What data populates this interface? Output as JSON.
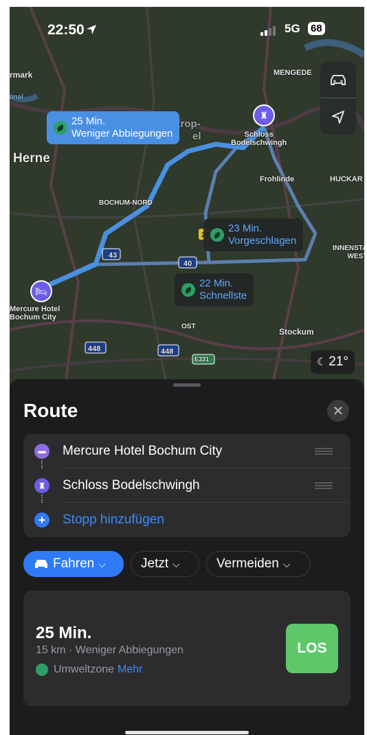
{
  "status": {
    "time": "22:50",
    "network": "5G",
    "battery": "68"
  },
  "map": {
    "labels": {
      "mark": "rmark",
      "mengede": "MENGEDE",
      "herne": "Herne",
      "castrop": "Castrop-",
      "castrop2": "el",
      "schloss": "Schloss\nBodelschwingh",
      "frohlinde": "Frohlinde",
      "huckar": "HUCKAR",
      "bochum_nord": "BOCHUM-NORD",
      "innenstadt": "INNENSTA\nWEST",
      "mercure": "Mercure Hotel\nBochum City",
      "ost": "OST",
      "stockum": "Stockum",
      "anal": "anal"
    },
    "shields": {
      "a43": "43",
      "a40": "40",
      "a448a": "448",
      "a448b": "448",
      "e331": "E331",
      "b23": "23"
    },
    "callouts": [
      {
        "time": "25 Min.",
        "desc": "Weniger Abbiegungen"
      },
      {
        "time": "23 Min.",
        "desc": "Vorgeschlagen"
      },
      {
        "time": "22 Min.",
        "desc": "Schnellste"
      }
    ],
    "weather": "21°"
  },
  "sheet": {
    "title": "Route",
    "stops": [
      {
        "label": "Mercure Hotel Bochum City",
        "color": "#8e6be0",
        "icon": "bed-icon"
      },
      {
        "label": "Schloss Bodelschwingh",
        "color": "#6c5ce7",
        "icon": "castle-icon"
      }
    ],
    "add_stop": "Stopp hinzufügen",
    "chips": {
      "mode": "Fahren",
      "time": "Jetzt",
      "avoid": "Vermeiden"
    },
    "route": {
      "duration": "25 Min.",
      "details": "15 km · Weniger Abbiegungen",
      "zone": "Umweltzone",
      "more": "Mehr",
      "go": "LOS"
    }
  },
  "colors": {
    "accent": "#2f7bf6",
    "route_selected": "#4a90e2",
    "go": "#5ec76a",
    "leaf": "#2e9e67"
  }
}
